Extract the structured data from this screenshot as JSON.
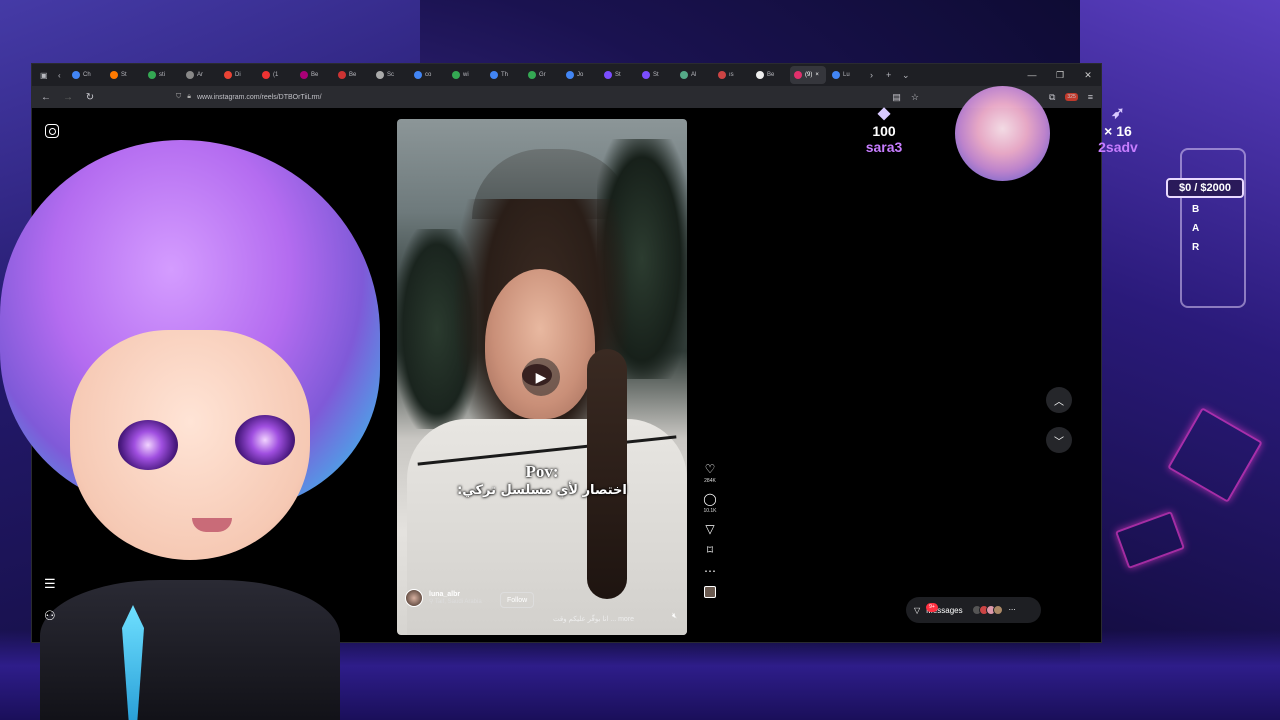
{
  "browser": {
    "tabs": [
      {
        "label": "Ch"
      },
      {
        "label": "St"
      },
      {
        "label": "sti"
      },
      {
        "label": "Ar"
      },
      {
        "label": "Di"
      },
      {
        "label": "(1"
      },
      {
        "label": "Be"
      },
      {
        "label": "Be"
      },
      {
        "label": "Sc"
      },
      {
        "label": "co"
      },
      {
        "label": "wi"
      },
      {
        "label": "Th"
      },
      {
        "label": "Gr"
      },
      {
        "label": "Jo"
      },
      {
        "label": "St"
      },
      {
        "label": "St"
      },
      {
        "label": "Al"
      },
      {
        "label": "ıs"
      },
      {
        "label": "Be"
      },
      {
        "label": "(9)"
      },
      {
        "label": "Lu"
      }
    ],
    "active_tab_index": 19,
    "url": "www.instagram.com/reels/DTBOrTiiLrm/",
    "extension_badge": "325"
  },
  "reel": {
    "caption_title": "Pov:",
    "caption_text": "اختصار لأي مسلسل تركي:",
    "author_name": "luna_albr",
    "author_location": "Taif, Saudi Arabia",
    "follow_label": "Follow",
    "description": "انا بوقّر عليكم وقت ... more"
  },
  "actions": {
    "likes": "284K",
    "comments": "10.1K"
  },
  "messages": {
    "label": "Messages",
    "badge": "9+"
  },
  "overlay": {
    "left_stat_value": "100",
    "left_stat_name": "sara3",
    "right_stat_value": "× 16",
    "right_stat_name": "2sadv",
    "goal": "$0 / $2000",
    "bar_letters": [
      "B",
      "A",
      "R"
    ]
  }
}
